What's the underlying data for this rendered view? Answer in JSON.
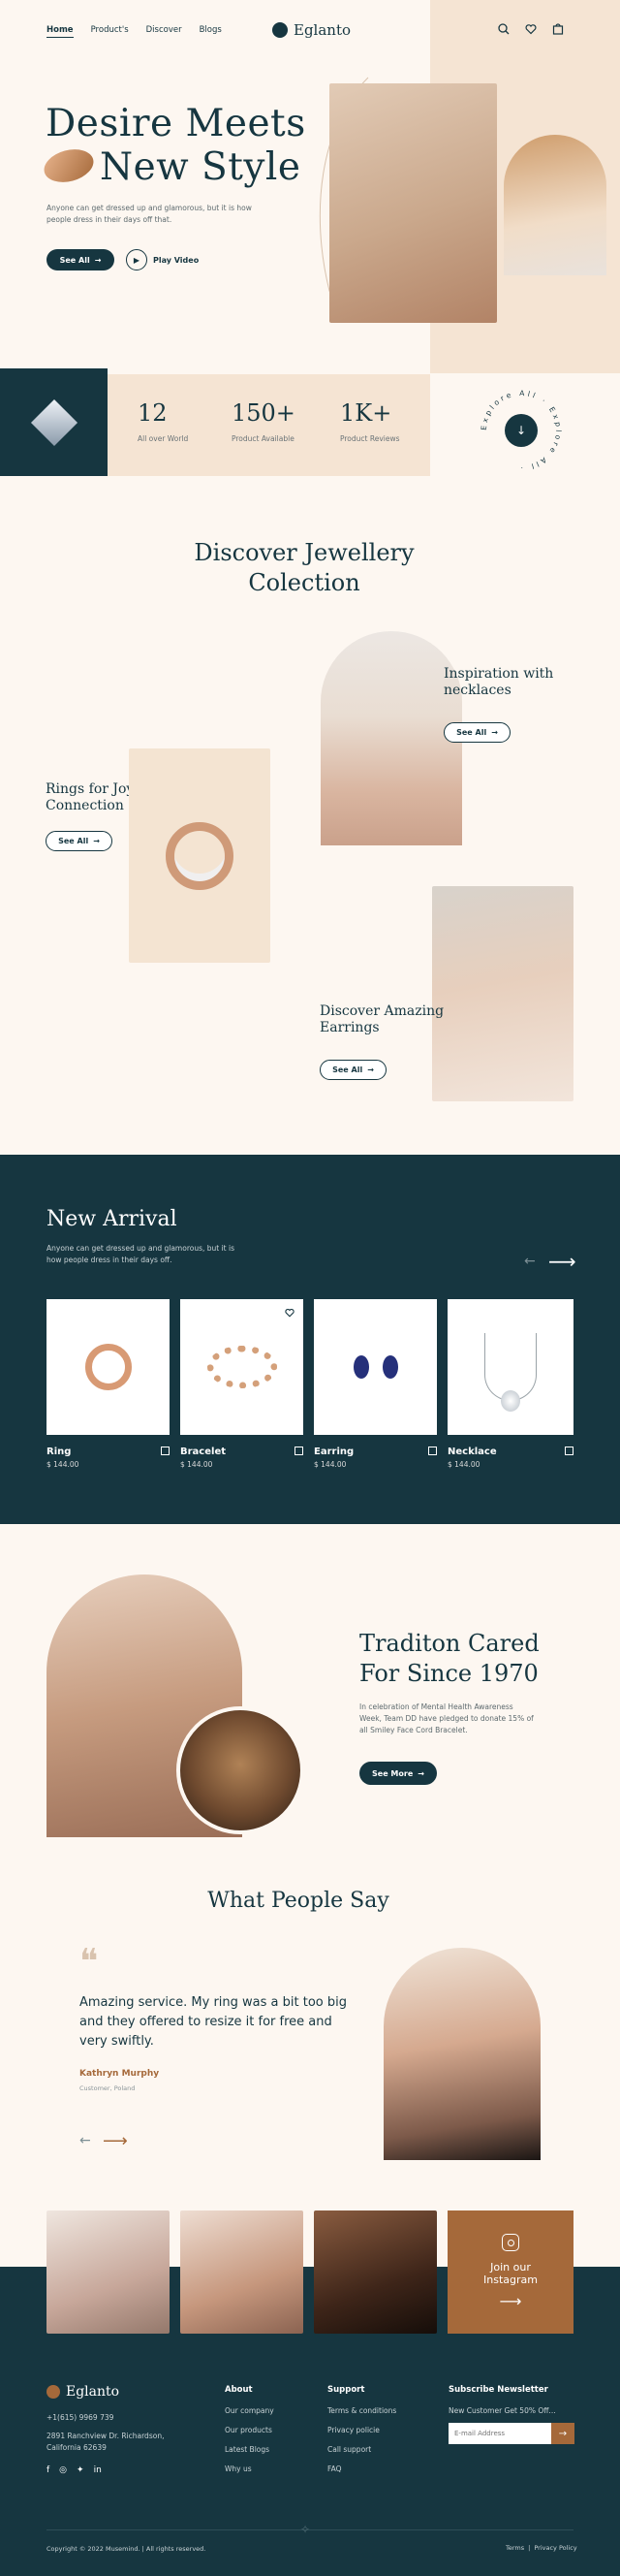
{
  "nav": {
    "items": [
      "Home",
      "Product's",
      "Discover",
      "Blogs"
    ],
    "logo": "Eglanto"
  },
  "hero": {
    "title_line1": "Desire Meets",
    "title_line2": "New Style",
    "description": "Anyone can get dressed up and glamorous, but it is how people dress in their days off that.",
    "see_all": "See All",
    "play_video": "Play Video"
  },
  "stats": [
    {
      "value": "12",
      "label": "All over World"
    },
    {
      "value": "150+",
      "label": "Product Available"
    },
    {
      "value": "1K+",
      "label": "Product Reviews"
    }
  ],
  "explore_badge": "Explore All · Explore All ·",
  "collection": {
    "title_line1": "Discover Jewellery",
    "title_line2": "Colection",
    "necklaces_title": "Inspiration with necklaces",
    "rings_title": "Rings for Joyful Connection",
    "earrings_title": "Discover Amazing Earrings",
    "see_all": "See All"
  },
  "arrival": {
    "title": "New Arrival",
    "description": "Anyone can get dressed up and glamorous, but it is how people dress in their days off.",
    "products": [
      {
        "name": "Ring",
        "price": "$ 144.00"
      },
      {
        "name": "Bracelet",
        "price": "$ 144.00"
      },
      {
        "name": "Earring",
        "price": "$ 144.00"
      },
      {
        "name": "Necklace",
        "price": "$ 144.00"
      }
    ]
  },
  "tradition": {
    "title_line1": "Traditon Cared",
    "title_line2": "For Since 1970",
    "description": "In celebration of Mental Health Awareness Week, Team DD have pledged to donate 15% of all Smiley Face Cord Bracelet.",
    "see_more": "See More"
  },
  "testimonial": {
    "title": "What People Say",
    "quote": "Amazing service. My ring was a bit too big and they offered to resize it for free and very swiftly.",
    "name": "Kathryn Murphy",
    "role": "Customer, Poland"
  },
  "instagram": {
    "label_line1": "Join our",
    "label_line2": "Instagram"
  },
  "footer": {
    "logo": "Eglanto",
    "phone": "+1(615) 9969 739",
    "address_line1": "2891 Ranchview Dr. Richardson,",
    "address_line2": "California 62639",
    "about_head": "About",
    "about_links": [
      "Our company",
      "Our products",
      "Latest Blogs",
      "Why us"
    ],
    "support_head": "Support",
    "support_links": [
      "Terms & conditions",
      "Privacy policie",
      "Call support",
      "FAQ"
    ],
    "newsletter_head": "Subscribe Newsletter",
    "newsletter_text": "New Customer Get 50% Off...",
    "email_placeholder": "E-mail Address",
    "copyright": "Copyright © 2022 Musemind. | All rights reserved.",
    "terms": "Terms",
    "privacy": "Privacy Policy"
  },
  "colors": {
    "primary": "#163640",
    "cream": "#fdf7f1",
    "peach": "#f5e4d3",
    "accent": "#a5693a"
  }
}
